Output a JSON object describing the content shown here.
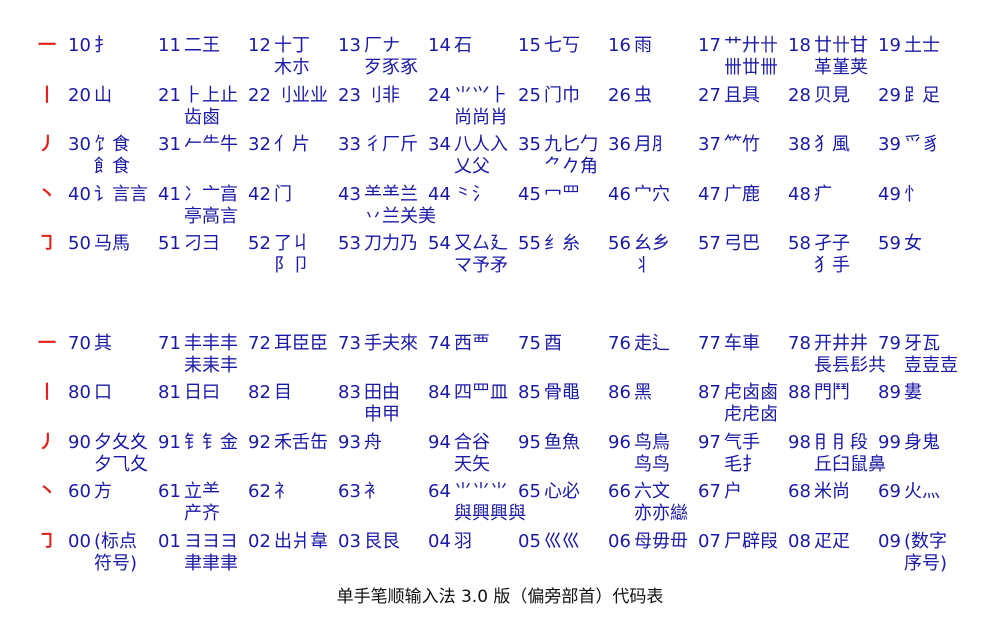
{
  "caption": "单手笔顺输入法 3.0 版（偏旁部首）代码表",
  "colors": {
    "stroke": "#e0201a",
    "text": "#1a1aa6",
    "caption": "#111111"
  },
  "rows": [
    {
      "stroke": "一",
      "cells": [
        {
          "code": "10",
          "c1": "扌",
          "c2": ""
        },
        {
          "code": "11",
          "c1": "二王",
          "c2": ""
        },
        {
          "code": "12",
          "c1": "十丁",
          "c2": "木朩"
        },
        {
          "code": "13",
          "c1": "厂ナ",
          "c2": "歹豕豖"
        },
        {
          "code": "14",
          "c1": "石",
          "c2": ""
        },
        {
          "code": "15",
          "c1": "七丂",
          "c2": ""
        },
        {
          "code": "16",
          "c1": "雨",
          "c2": ""
        },
        {
          "code": "17",
          "c1": "艹廾卄",
          "c2": "卌丗卌"
        },
        {
          "code": "18",
          "c1": "廿卄甘",
          "c2": "革堇荚"
        },
        {
          "code": "19",
          "c1": "土士",
          "c2": ""
        }
      ]
    },
    {
      "stroke": "丨",
      "cells": [
        {
          "code": "20",
          "c1": "山",
          "c2": ""
        },
        {
          "code": "21",
          "c1": "⺊上止",
          "c2": "齿鹵"
        },
        {
          "code": "22",
          "c1": "刂业业",
          "c2": ""
        },
        {
          "code": "23",
          "c1": "刂非",
          "c2": ""
        },
        {
          "code": "24",
          "c1": "⺌⺍⺊",
          "c2": "尚尚肖"
        },
        {
          "code": "25",
          "c1": "门巾",
          "c2": ""
        },
        {
          "code": "26",
          "c1": "虫",
          "c2": ""
        },
        {
          "code": "27",
          "c1": "且具",
          "c2": ""
        },
        {
          "code": "28",
          "c1": "贝見",
          "c2": ""
        },
        {
          "code": "29",
          "c1": "𧾷足",
          "c2": ""
        }
      ]
    },
    {
      "stroke": "丿",
      "cells": [
        {
          "code": "30",
          "c1": "饣食",
          "c2": "飠食"
        },
        {
          "code": "31",
          "c1": "𠂉⺧牛",
          "c2": ""
        },
        {
          "code": "32",
          "c1": "亻片",
          "c2": ""
        },
        {
          "code": "33",
          "c1": "彳厂斤",
          "c2": ""
        },
        {
          "code": "34",
          "c1": "八人入",
          "c2": "乂父"
        },
        {
          "code": "35",
          "c1": "九匕勹",
          "c2": "⺈𠂊角"
        },
        {
          "code": "36",
          "c1": "月⺼",
          "c2": ""
        },
        {
          "code": "37",
          "c1": "⺮竹",
          "c2": ""
        },
        {
          "code": "38",
          "c1": "犭風",
          "c2": ""
        },
        {
          "code": "39",
          "c1": "爫豸",
          "c2": ""
        }
      ]
    },
    {
      "stroke": "丶",
      "cells": [
        {
          "code": "40",
          "c1": "讠言言",
          "c2": ""
        },
        {
          "code": "41",
          "c1": "冫亠亯",
          "c2": "亭高言"
        },
        {
          "code": "42",
          "c1": "门",
          "c2": ""
        },
        {
          "code": "43",
          "c1": "⺷⺷兰",
          "c2": "丷兰关美"
        },
        {
          "code": "44",
          "c1": "⺀氵",
          "c2": ""
        },
        {
          "code": "45",
          "c1": "冖罒",
          "c2": ""
        },
        {
          "code": "46",
          "c1": "宀穴",
          "c2": ""
        },
        {
          "code": "47",
          "c1": "广鹿",
          "c2": ""
        },
        {
          "code": "48",
          "c1": "疒",
          "c2": ""
        },
        {
          "code": "49",
          "c1": "忄",
          "c2": ""
        }
      ]
    },
    {
      "stroke": "㇆",
      "cells": [
        {
          "code": "50",
          "c1": "马馬",
          "c2": ""
        },
        {
          "code": "51",
          "c1": "刁⺕",
          "c2": ""
        },
        {
          "code": "52",
          "c1": "了丩",
          "c2": "阝卩"
        },
        {
          "code": "53",
          "c1": "刀力乃",
          "c2": ""
        },
        {
          "code": "54",
          "c1": "又厶廴",
          "c2": "マ予矛"
        },
        {
          "code": "55",
          "c1": "纟糸",
          "c2": ""
        },
        {
          "code": "56",
          "c1": "幺乡",
          "c2": "⺦"
        },
        {
          "code": "57",
          "c1": "弓巴",
          "c2": ""
        },
        {
          "code": "58",
          "c1": "孑子",
          "c2": "⺨手"
        },
        {
          "code": "59",
          "c1": "女",
          "c2": ""
        }
      ]
    },
    {
      "stroke": "一",
      "cells": [
        {
          "code": "70",
          "c1": "其",
          "c2": ""
        },
        {
          "code": "71",
          "c1": "丰丰丰",
          "c2": "耒耒丰"
        },
        {
          "code": "72",
          "c1": "耳臣臣",
          "c2": ""
        },
        {
          "code": "73",
          "c1": "手夫來",
          "c2": ""
        },
        {
          "code": "74",
          "c1": "西覀",
          "c2": ""
        },
        {
          "code": "75",
          "c1": "酉",
          "c2": ""
        },
        {
          "code": "76",
          "c1": "走⻍",
          "c2": ""
        },
        {
          "code": "77",
          "c1": "车車",
          "c2": ""
        },
        {
          "code": "78",
          "c1": "开井井",
          "c2": "長镸髟共"
        },
        {
          "code": "79",
          "c1": "牙瓦",
          "c2": "壴壴壴"
        }
      ]
    },
    {
      "stroke": "丨",
      "cells": [
        {
          "code": "80",
          "c1": "口",
          "c2": ""
        },
        {
          "code": "81",
          "c1": "日曰",
          "c2": ""
        },
        {
          "code": "82",
          "c1": "目",
          "c2": ""
        },
        {
          "code": "83",
          "c1": "田由",
          "c2": "申甲"
        },
        {
          "code": "84",
          "c1": "四罒皿",
          "c2": ""
        },
        {
          "code": "85",
          "c1": "骨黽",
          "c2": ""
        },
        {
          "code": "86",
          "c1": "黑",
          "c2": ""
        },
        {
          "code": "87",
          "c1": "虍卤鹵",
          "c2": "虍虍卤"
        },
        {
          "code": "88",
          "c1": "門鬥",
          "c2": ""
        },
        {
          "code": "89",
          "c1": "婁",
          "c2": ""
        }
      ]
    },
    {
      "stroke": "丿",
      "cells": [
        {
          "code": "90",
          "c1": "夕夂夊",
          "c2": "夕⺄夂"
        },
        {
          "code": "91",
          "c1": "钅⻐金",
          "c2": ""
        },
        {
          "code": "92",
          "c1": "禾舌缶",
          "c2": ""
        },
        {
          "code": "93",
          "c1": "舟",
          "c2": ""
        },
        {
          "code": "94",
          "c1": "合谷",
          "c2": "天矢"
        },
        {
          "code": "95",
          "c1": "鱼魚",
          "c2": ""
        },
        {
          "code": "96",
          "c1": "鸟鳥",
          "c2": "鸟鸟"
        },
        {
          "code": "97",
          "c1": "气手",
          "c2": "毛⺘"
        },
        {
          "code": "98",
          "c1": "⺝⺝段",
          "c2": "丘臼鼠鼻"
        },
        {
          "code": "99",
          "c1": "身鬼",
          "c2": ""
        }
      ]
    },
    {
      "stroke": "丶",
      "cells": [
        {
          "code": "60",
          "c1": "方",
          "c2": ""
        },
        {
          "code": "61",
          "c1": "立⺷",
          "c2": "产齐"
        },
        {
          "code": "62",
          "c1": "礻",
          "c2": ""
        },
        {
          "code": "63",
          "c1": "衤",
          "c2": ""
        },
        {
          "code": "64",
          "c1": "⺌⺌⺌",
          "c2": "與興興與"
        },
        {
          "code": "65",
          "c1": "心必",
          "c2": ""
        },
        {
          "code": "66",
          "c1": "六文",
          "c2": "亦亦䜌"
        },
        {
          "code": "67",
          "c1": "户",
          "c2": ""
        },
        {
          "code": "68",
          "c1": "米尚",
          "c2": ""
        },
        {
          "code": "69",
          "c1": "火灬",
          "c2": ""
        }
      ]
    },
    {
      "stroke": "㇆",
      "cells": [
        {
          "code": "00",
          "c1": "(标点",
          "c2": "符号)"
        },
        {
          "code": "01",
          "c1": "ヨヨヨ",
          "c2": "聿聿聿"
        },
        {
          "code": "02",
          "c1": "出爿韋",
          "c2": ""
        },
        {
          "code": "03",
          "c1": "艮艮",
          "c2": ""
        },
        {
          "code": "04",
          "c1": "羽",
          "c2": ""
        },
        {
          "code": "05",
          "c1": "巛巛",
          "c2": ""
        },
        {
          "code": "06",
          "c1": "母毋毌",
          "c2": ""
        },
        {
          "code": "07",
          "c1": "尸辟叚",
          "c2": ""
        },
        {
          "code": "08",
          "c1": "疋疋",
          "c2": ""
        },
        {
          "code": "09",
          "c1": "(数字",
          "c2": "序号)"
        }
      ]
    }
  ]
}
